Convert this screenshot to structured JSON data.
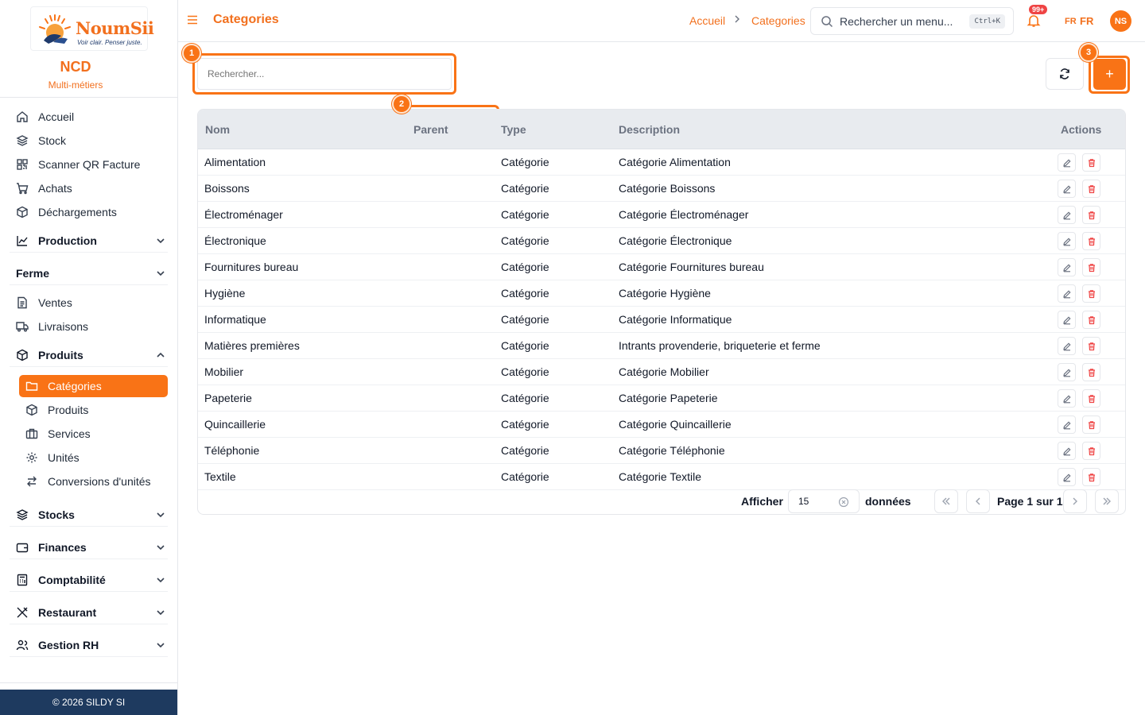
{
  "brand": {
    "logo_name": "NoumSii",
    "logo_tagline": "Voir clair. Penser juste.",
    "company": "NCD",
    "company_sub": "Multi-métiers",
    "footer": "© 2026 SILDY SI"
  },
  "sidebar": {
    "items": [
      {
        "label": "Accueil",
        "icon": "home-icon"
      },
      {
        "label": "Stock",
        "icon": "layers-icon"
      },
      {
        "label": "Scanner QR Facture",
        "icon": "qr-icon"
      },
      {
        "label": "Achats",
        "icon": "cart-icon"
      },
      {
        "label": "Déchargements",
        "icon": "box-icon"
      }
    ],
    "groups": [
      {
        "label": "Production",
        "icon": "chart-icon"
      },
      {
        "label": "Ferme",
        "icon": ""
      },
      {
        "label": "Produits",
        "icon": "box-icon"
      },
      {
        "label": "Stocks",
        "icon": "layers-icon"
      },
      {
        "label": "Finances",
        "icon": "wallet-icon"
      },
      {
        "label": "Comptabilité",
        "icon": "calculator-icon"
      },
      {
        "label": "Restaurant",
        "icon": "utensils-icon"
      },
      {
        "label": "Gestion RH",
        "icon": "users-icon"
      }
    ],
    "ferme_items": [
      {
        "label": "Ventes",
        "icon": "file-icon"
      },
      {
        "label": "Livraisons",
        "icon": "truck-icon"
      }
    ],
    "produits_items": [
      {
        "label": "Catégories",
        "icon": "folder-icon",
        "active": true
      },
      {
        "label": "Produits",
        "icon": "box-icon"
      },
      {
        "label": "Services",
        "icon": "briefcase-icon"
      },
      {
        "label": "Unités",
        "icon": "gear-icon"
      },
      {
        "label": "Conversions d'unités",
        "icon": "swap-icon"
      }
    ]
  },
  "header": {
    "title": "Categories",
    "breadcrumb": [
      "Accueil",
      "Categories"
    ],
    "search_placeholder": "Rechercher un menu...",
    "shortcut": "Ctrl+K",
    "notifications": "99+",
    "lang_flag": "FR",
    "lang": "FR",
    "avatar": "NS"
  },
  "toolbar": {
    "search_placeholder": "Rechercher...",
    "markers": [
      "1",
      "2",
      "3"
    ],
    "add_label": "+"
  },
  "table": {
    "columns": [
      "Nom",
      "Parent",
      "Type",
      "Description",
      "Actions"
    ],
    "rows": [
      {
        "nom": "Alimentation",
        "parent": "",
        "type": "Catégorie",
        "description": "Catégorie Alimentation"
      },
      {
        "nom": "Boissons",
        "parent": "",
        "type": "Catégorie",
        "description": "Catégorie Boissons"
      },
      {
        "nom": "Électroménager",
        "parent": "",
        "type": "Catégorie",
        "description": "Catégorie Électroménager"
      },
      {
        "nom": "Électronique",
        "parent": "",
        "type": "Catégorie",
        "description": "Catégorie Électronique"
      },
      {
        "nom": "Fournitures bureau",
        "parent": "",
        "type": "Catégorie",
        "description": "Catégorie Fournitures bureau"
      },
      {
        "nom": "Hygiène",
        "parent": "",
        "type": "Catégorie",
        "description": "Catégorie Hygiène"
      },
      {
        "nom": "Informatique",
        "parent": "",
        "type": "Catégorie",
        "description": "Catégorie Informatique"
      },
      {
        "nom": "Matières premières",
        "parent": "",
        "type": "Catégorie",
        "description": "Intrants provenderie, briqueterie et ferme"
      },
      {
        "nom": "Mobilier",
        "parent": "",
        "type": "Catégorie",
        "description": "Catégorie Mobilier"
      },
      {
        "nom": "Papeterie",
        "parent": "",
        "type": "Catégorie",
        "description": "Catégorie Papeterie"
      },
      {
        "nom": "Quincaillerie",
        "parent": "",
        "type": "Catégorie",
        "description": "Catégorie Quincaillerie"
      },
      {
        "nom": "Téléphonie",
        "parent": "",
        "type": "Catégorie",
        "description": "Catégorie Téléphonie"
      },
      {
        "nom": "Textile",
        "parent": "",
        "type": "Catégorie",
        "description": "Catégorie Textile"
      }
    ]
  },
  "pager": {
    "show_label": "Afficher",
    "page_size": "15",
    "unit_label": "données",
    "page_info": "Page 1 sur 1"
  },
  "colors": {
    "accent": "#f97316",
    "footer": "#1e3a5f",
    "danger": "#ef4444"
  }
}
